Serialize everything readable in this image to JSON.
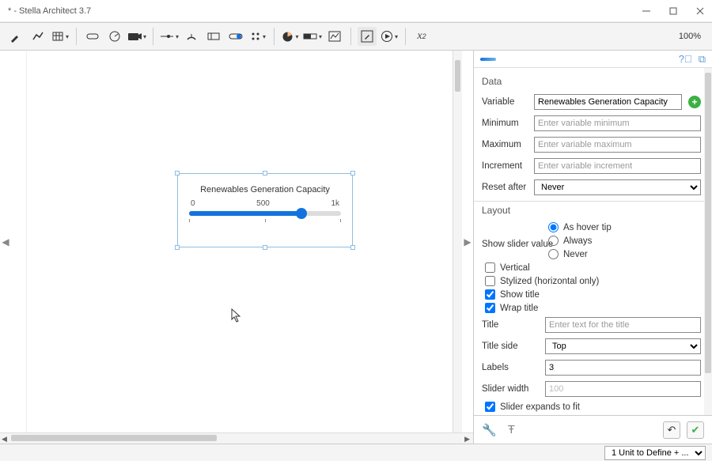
{
  "window": {
    "title": "* - Stella Architect 3.7",
    "zoom": "100%"
  },
  "canvas": {
    "widget": {
      "title": "Renewables Generation Capacity",
      "scale_min": "0",
      "scale_mid": "500",
      "scale_max": "1k"
    }
  },
  "panel": {
    "data_header": "Data",
    "variable_label": "Variable",
    "variable_value": "Renewables Generation Capacity",
    "minimum_label": "Minimum",
    "minimum_placeholder": "Enter variable minimum",
    "maximum_label": "Maximum",
    "maximum_placeholder": "Enter variable maximum",
    "increment_label": "Increment",
    "increment_placeholder": "Enter variable increment",
    "reset_label": "Reset after",
    "reset_value": "Never",
    "layout_header": "Layout",
    "show_slider_label": "Show slider value",
    "radio_hover": "As hover tip",
    "radio_always": "Always",
    "radio_never": "Never",
    "check_vertical": "Vertical",
    "check_stylized": "Stylized (horizontal only)",
    "check_show_title": "Show title",
    "check_wrap_title": "Wrap title",
    "title_label": "Title",
    "title_placeholder": "Enter text for the title",
    "title_side_label": "Title side",
    "title_side_value": "Top",
    "labels_label": "Labels",
    "labels_value": "3",
    "slider_width_label": "Slider width",
    "slider_width_value": "100",
    "check_expands": "Slider expands to fit"
  },
  "status": {
    "units_text": "1 Unit to Define + ..."
  }
}
